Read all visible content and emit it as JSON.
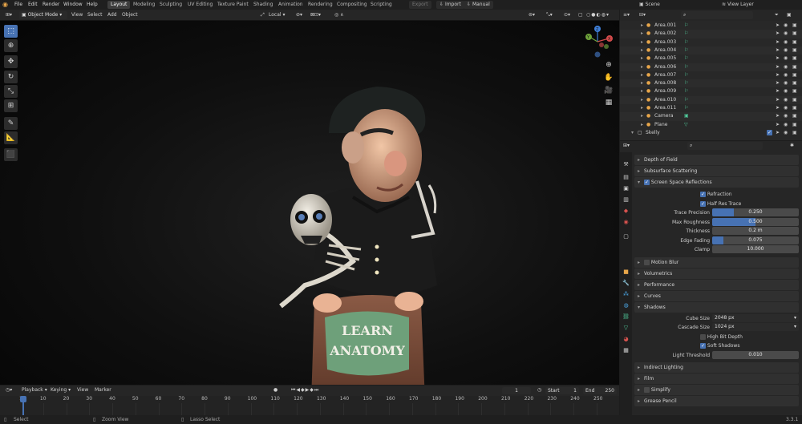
{
  "menubar": {
    "items": [
      "File",
      "Edit",
      "Render",
      "Window",
      "Help"
    ],
    "workspaces": [
      "Layout",
      "Modeling",
      "Sculpting",
      "UV Editing",
      "Texture Paint",
      "Shading",
      "Animation",
      "Rendering",
      "Compositing",
      "Scripting"
    ],
    "active_workspace": "Layout",
    "export_label": "Export",
    "import_label": "Import",
    "manual_label": "Manual",
    "scene_label": "Scene",
    "view_layer_label": "View Layer"
  },
  "viewport_header": {
    "mode": "Object Mode",
    "menus": [
      "View",
      "Select",
      "Add",
      "Object"
    ],
    "orientation": "Local"
  },
  "viewport": {
    "artwork_text_line1": "LEARN",
    "artwork_text_line2": "ANATOMY",
    "gizmo": {
      "x": "X",
      "y": "Y",
      "z": "Z"
    }
  },
  "timeline": {
    "menus": [
      "Playback",
      "Keying",
      "View",
      "Marker"
    ],
    "current_frame": "1",
    "start_label": "Start",
    "start": "1",
    "end_label": "End",
    "end": "250",
    "ticks": [
      "1",
      "10",
      "20",
      "30",
      "40",
      "50",
      "60",
      "70",
      "80",
      "90",
      "100",
      "110",
      "120",
      "130",
      "140",
      "150",
      "160",
      "170",
      "180",
      "190",
      "200",
      "210",
      "220",
      "230",
      "240",
      "250"
    ]
  },
  "statusbar": {
    "select": "Select",
    "zoom": "Zoom View",
    "lasso": "Lasso Select",
    "version": "3.3.1"
  },
  "outliner": {
    "items": [
      "Area.001",
      "Area.002",
      "Area.003",
      "Area.004",
      "Area.005",
      "Area.006",
      "Area.007",
      "Area.008",
      "Area.009",
      "Area.010",
      "Area.011",
      "Camera",
      "Plane"
    ],
    "collection": "Skelly"
  },
  "properties": {
    "sections_top": [
      "Depth of Field",
      "Subsurface Scattering"
    ],
    "ssr": {
      "title": "Screen Space Reflections",
      "refraction": "Refraction",
      "half_res": "Half Res Trace",
      "rows": [
        {
          "label": "Trace Precision",
          "value": "0.250",
          "fraction": 0.25
        },
        {
          "label": "Max Roughness",
          "value": "0.500",
          "fraction": 0.5
        },
        {
          "label": "Thickness",
          "value": "0.2 m",
          "fraction": 0
        },
        {
          "label": "Edge Fading",
          "value": "0.075",
          "fraction": 0.13
        },
        {
          "label": "Clamp",
          "value": "10.000",
          "fraction": 0
        }
      ]
    },
    "sections_mid": [
      "Motion Blur",
      "Volumetrics",
      "Performance",
      "Curves"
    ],
    "shadows": {
      "title": "Shadows",
      "cube_size_label": "Cube Size",
      "cube_size": "2048 px",
      "cascade_size_label": "Cascade Size",
      "cascade_size": "1024 px",
      "high_bit": "High Bit Depth",
      "soft": "Soft Shadows",
      "light_threshold_label": "Light Threshold",
      "light_threshold": "0.010"
    },
    "sections_bottom": [
      "Indirect Lighting",
      "Film",
      "Simplify",
      "Grease Pencil"
    ]
  },
  "colors": {
    "accent": "#4772b3",
    "bg": "#1d1d1d",
    "panel": "#303030"
  }
}
